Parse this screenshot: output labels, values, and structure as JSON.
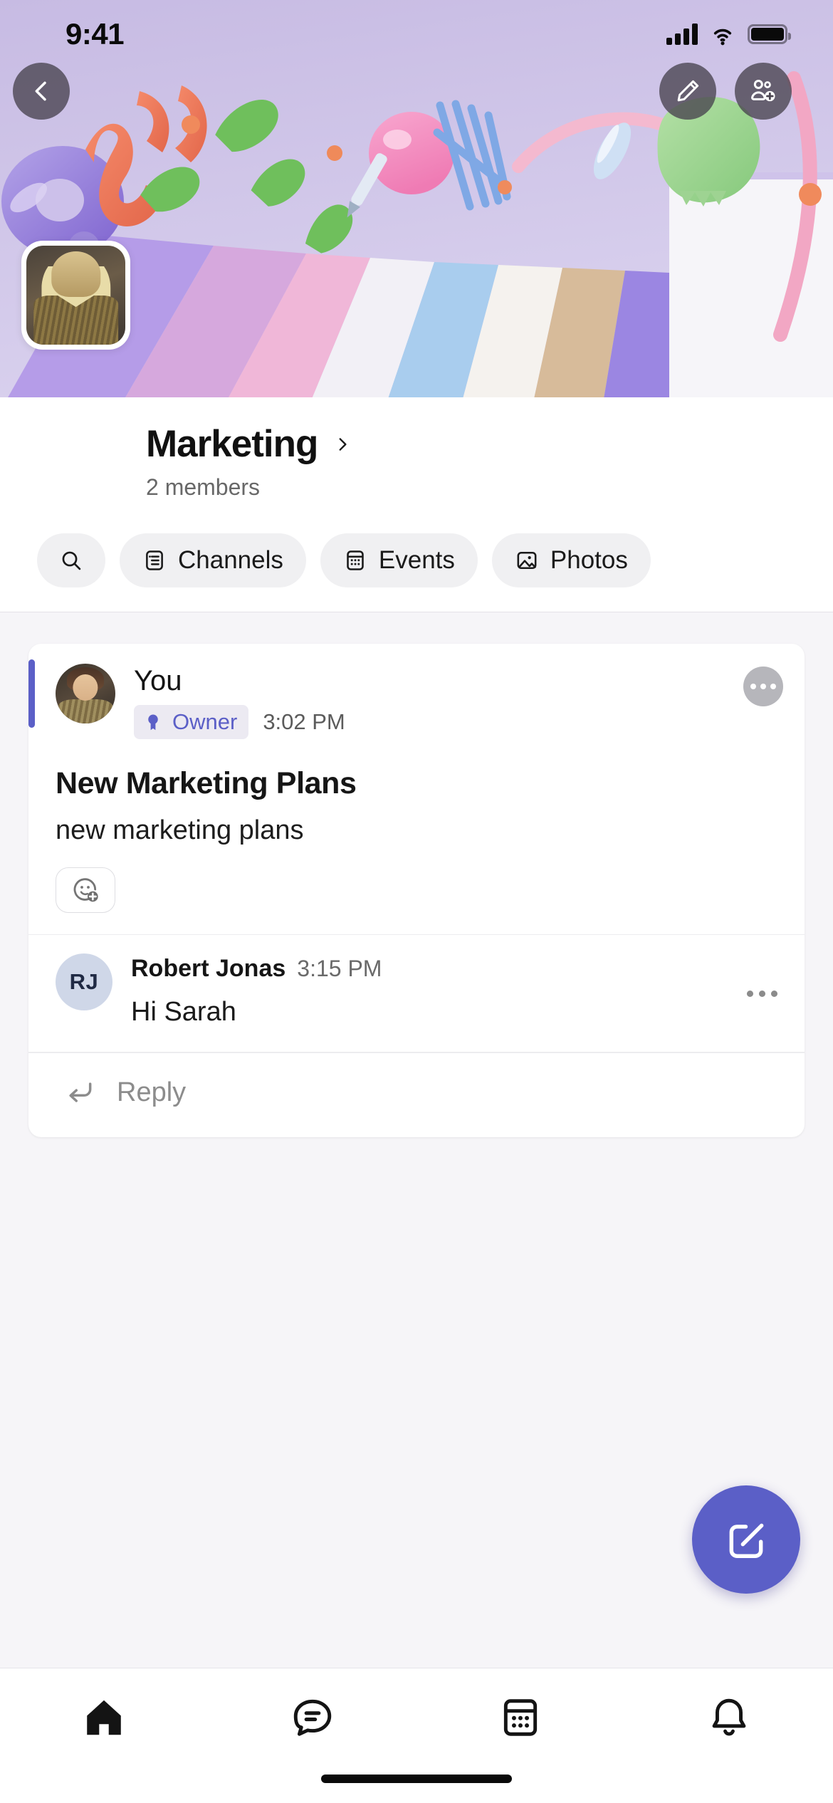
{
  "status_bar": {
    "time": "9:41",
    "signal_icon": "cellular-bars-icon",
    "wifi_icon": "wifi-icon",
    "battery_icon": "battery-full-icon"
  },
  "hero": {
    "background_color": "#cdc2e6",
    "back_button": {
      "icon": "chevron-left-icon",
      "label": "Back"
    },
    "edit_button": {
      "icon": "pencil-icon",
      "label": "Edit"
    },
    "add_people_button": {
      "icon": "add-people-icon",
      "label": "Add members"
    }
  },
  "profile": {
    "avatar_icon": "group-avatar-photo",
    "title": "Marketing",
    "chevron_icon": "chevron-right-icon",
    "members": "2 members"
  },
  "chips": [
    {
      "id": "search",
      "label": "",
      "icon": "search-icon",
      "icon_only": true
    },
    {
      "id": "channels",
      "label": "Channels",
      "icon": "channels-icon",
      "icon_only": false
    },
    {
      "id": "events",
      "label": "Events",
      "icon": "calendar-icon",
      "icon_only": false
    },
    {
      "id": "photos",
      "label": "Photos",
      "icon": "image-icon",
      "icon_only": false
    }
  ],
  "thread": {
    "accent_color": "#5b5fc7",
    "root_message": {
      "author": "You",
      "badge": {
        "label": "Owner",
        "icon": "award-icon",
        "color": "#5b5fc7"
      },
      "time": "3:02 PM",
      "title": "New Marketing Plans",
      "body": "new marketing plans",
      "more_icon": "more-options-icon",
      "add_reaction_icon": "add-reaction-icon"
    },
    "replies": [
      {
        "initials": "RJ",
        "author": "Robert Jonas",
        "time": "3:15 PM",
        "body": "Hi Sarah",
        "more_icon": "more-options-icon"
      }
    ],
    "reply_action": {
      "label": "Reply",
      "icon": "reply-arrow-icon"
    }
  },
  "fab": {
    "icon": "compose-icon",
    "label": "Compose",
    "color": "#5b5fc7"
  },
  "tabbar": [
    {
      "id": "home",
      "icon": "home-icon",
      "active": true
    },
    {
      "id": "chat",
      "icon": "chat-icon",
      "active": false
    },
    {
      "id": "calendar",
      "icon": "calendar-icon",
      "active": false
    },
    {
      "id": "notifications",
      "icon": "bell-icon",
      "active": false
    }
  ]
}
